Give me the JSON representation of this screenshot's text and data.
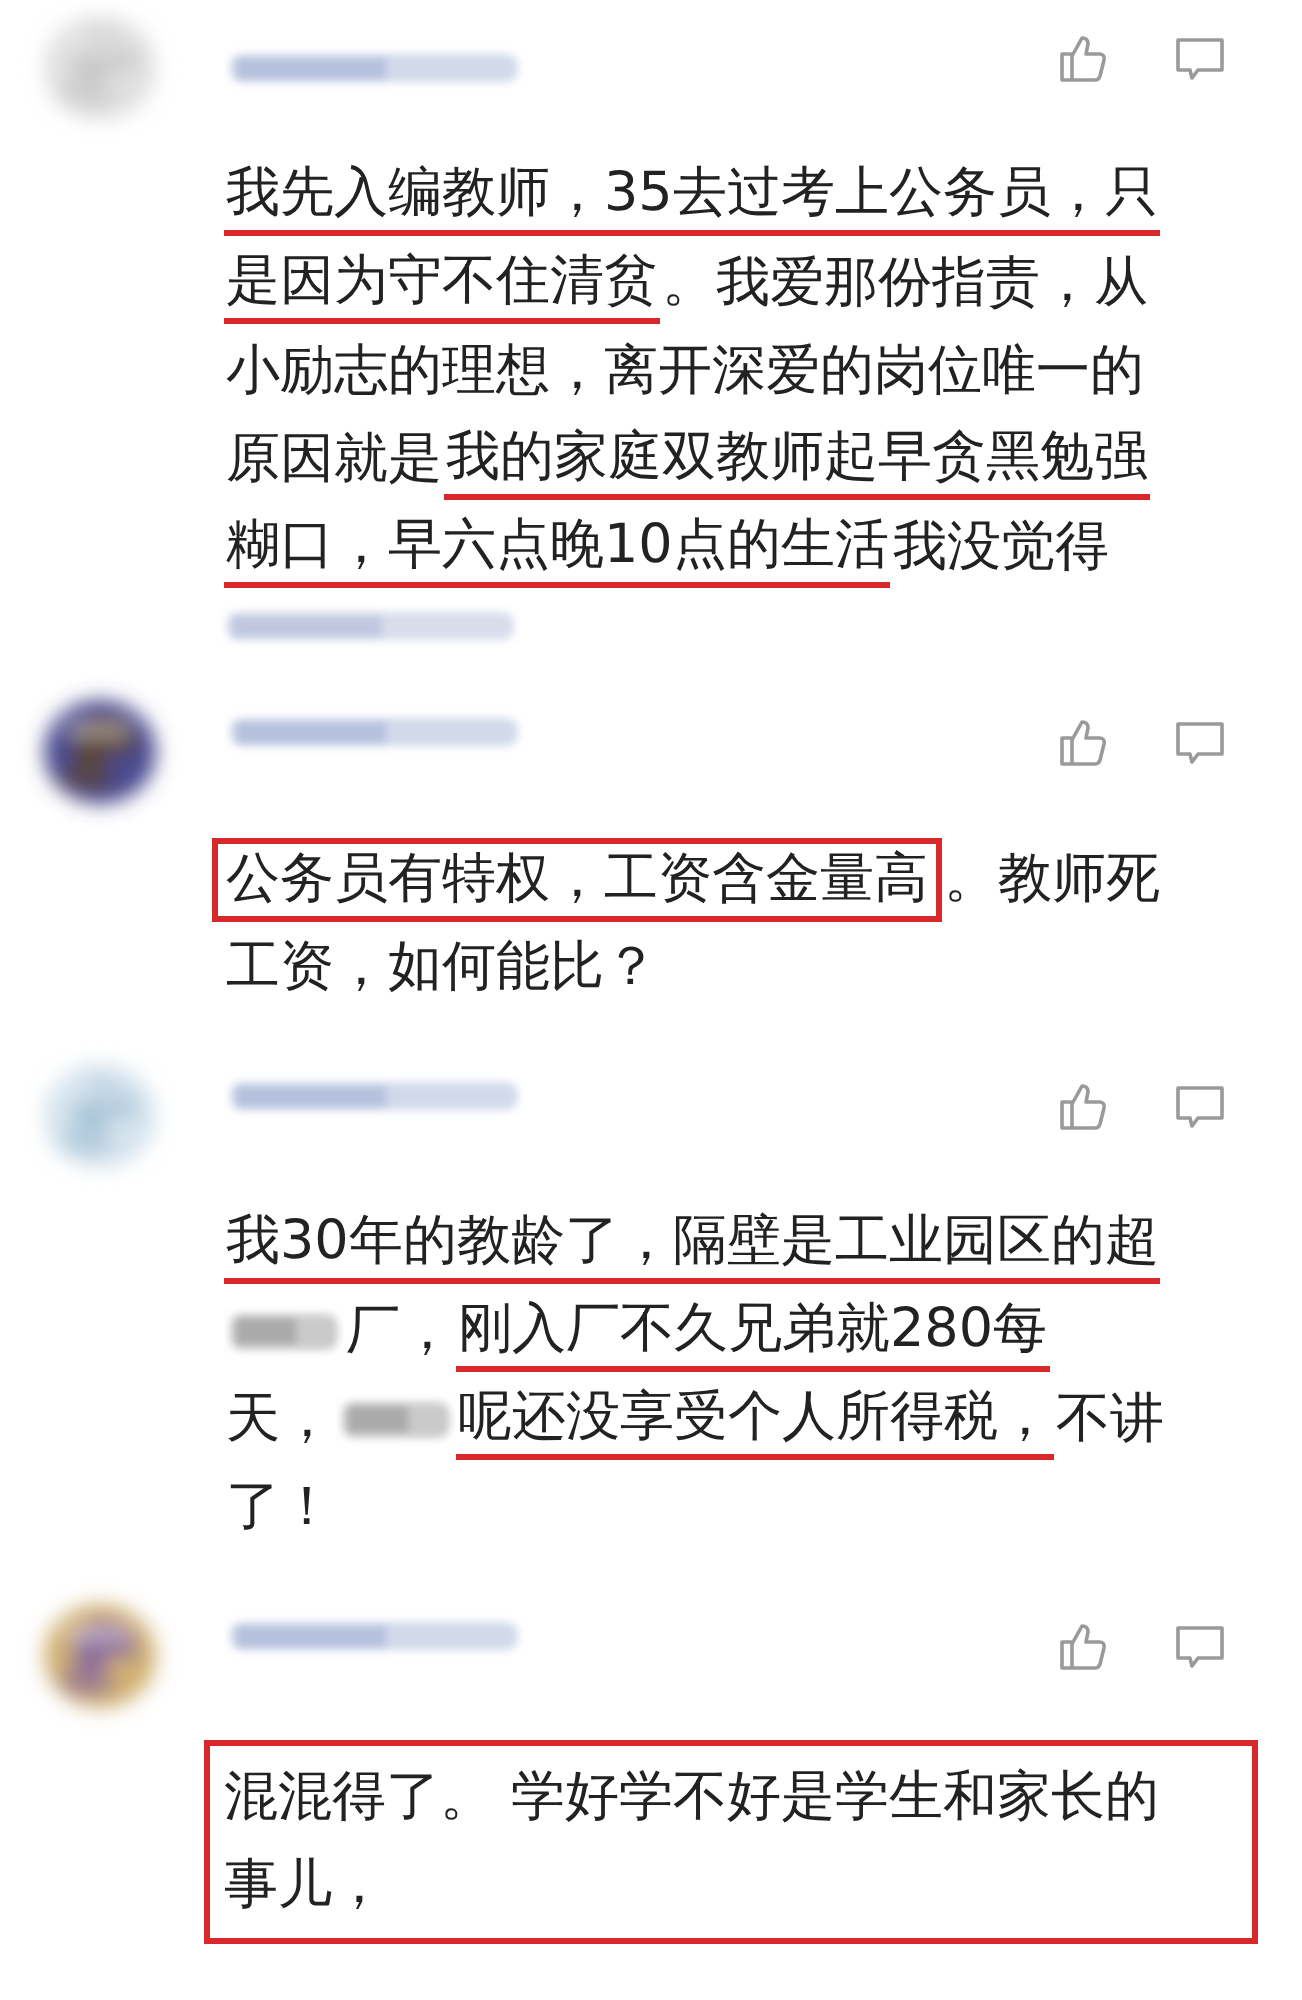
{
  "comments": [
    {
      "boxed": false,
      "footer_smudge": true,
      "lines": [
        [
          {
            "kind": "text",
            "text": "我先入编教师，35去过考上公务员，只",
            "underlined": true,
            "boxed": false
          }
        ],
        [
          {
            "kind": "text",
            "text": "是因为守不住清贫",
            "underlined": true,
            "boxed": false
          },
          {
            "kind": "text",
            "text": "。我爱那份指责，从",
            "underlined": false,
            "boxed": false
          }
        ],
        [
          {
            "kind": "text",
            "text": "小励志的理想，离开深爱的岗位唯一的",
            "underlined": false,
            "boxed": false
          }
        ],
        [
          {
            "kind": "text",
            "text": "原因就是",
            "underlined": false,
            "boxed": false
          },
          {
            "kind": "text",
            "text": "我的家庭双教师起早贪黑勉强",
            "underlined": true,
            "boxed": false
          }
        ],
        [
          {
            "kind": "text",
            "text": "糊口，早六点晚10点的生活",
            "underlined": true,
            "boxed": false
          },
          {
            "kind": "text",
            "text": "我没觉得",
            "underlined": false,
            "boxed": false
          }
        ]
      ]
    },
    {
      "boxed": false,
      "footer_smudge": false,
      "lines": [
        [
          {
            "kind": "text",
            "text": "公务员有特权，工资含金量高",
            "underlined": false,
            "boxed": true
          },
          {
            "kind": "text",
            "text": "。教师死",
            "underlined": false,
            "boxed": false
          }
        ],
        [
          {
            "kind": "text",
            "text": "工资，如何能比？",
            "underlined": false,
            "boxed": false
          }
        ]
      ]
    },
    {
      "boxed": false,
      "footer_smudge": false,
      "lines": [
        [
          {
            "kind": "text",
            "text": "我30年的教龄了，隔壁是工业园区的超",
            "underlined": true,
            "boxed": false
          }
        ],
        [
          {
            "kind": "smudge"
          },
          {
            "kind": "text",
            "text": "厂，",
            "underlined": false,
            "boxed": false
          },
          {
            "kind": "text",
            "text": "刚入厂不久兄弟就280每",
            "underlined": true,
            "boxed": false
          }
        ],
        [
          {
            "kind": "text",
            "text": "天，",
            "underlined": false,
            "boxed": false
          },
          {
            "kind": "smudge"
          },
          {
            "kind": "text",
            "text": "呢还没享受个人所得税，",
            "underlined": true,
            "boxed": false
          },
          {
            "kind": "text",
            "text": "不讲",
            "underlined": false,
            "boxed": false
          }
        ],
        [
          {
            "kind": "text",
            "text": "了！",
            "underlined": false,
            "boxed": false
          }
        ]
      ]
    },
    {
      "boxed": true,
      "footer_smudge": false,
      "lines": [
        [
          {
            "kind": "text",
            "text": "混混得了。 学好学不好是学生和家长的",
            "underlined": false,
            "boxed": false
          }
        ],
        [
          {
            "kind": "text",
            "text": "事儿，",
            "underlined": false,
            "boxed": false
          }
        ]
      ]
    }
  ]
}
